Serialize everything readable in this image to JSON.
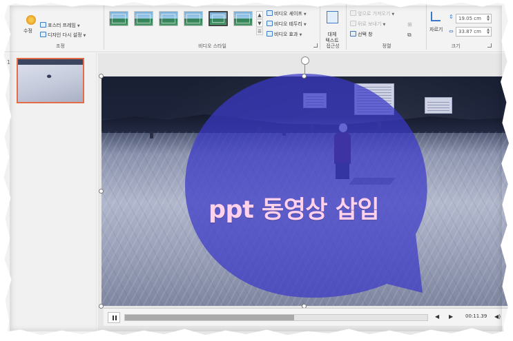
{
  "ribbon": {
    "adjust_group": {
      "correction_label": "수정",
      "poster_frame_label": "포스터 프레임",
      "reset_design_label": "디자인 다시 설정",
      "group_label": "조정"
    },
    "video_styles_group": {
      "thumb_count": 6,
      "selected_index": 4,
      "shape_label": "비디오 셰이프",
      "border_label": "비디오 테두리",
      "effects_label": "비디오 효과",
      "group_label": "비디오 스타일"
    },
    "accessibility_group": {
      "alt_text_label": "대체\n텍스트",
      "group_label": "접근성"
    },
    "arrange_group": {
      "bring_forward_label": "앞으로 가져오기",
      "send_backward_label": "뒤로 보내기",
      "selection_pane_label": "선택 창",
      "group_label": "정렬"
    },
    "size_group": {
      "crop_label": "자르기",
      "height_value": "19.05 cm",
      "width_value": "33.87 cm",
      "group_label": "크기"
    }
  },
  "slides_panel": {
    "slide_number": "1"
  },
  "slide": {
    "caption": "ppt 동영상 삽입",
    "bubble_color": "#3a39c8",
    "caption_color": "#ffd1ea"
  },
  "playback": {
    "progress": 0.56,
    "time": "00:11.39",
    "back_icon": "step-back-icon",
    "forward_icon": "step-forward-icon",
    "volume_icon": "volume-icon"
  },
  "colors": {
    "selection_border": "#e46b44",
    "ribbon_bg": "#f3f3f3"
  }
}
